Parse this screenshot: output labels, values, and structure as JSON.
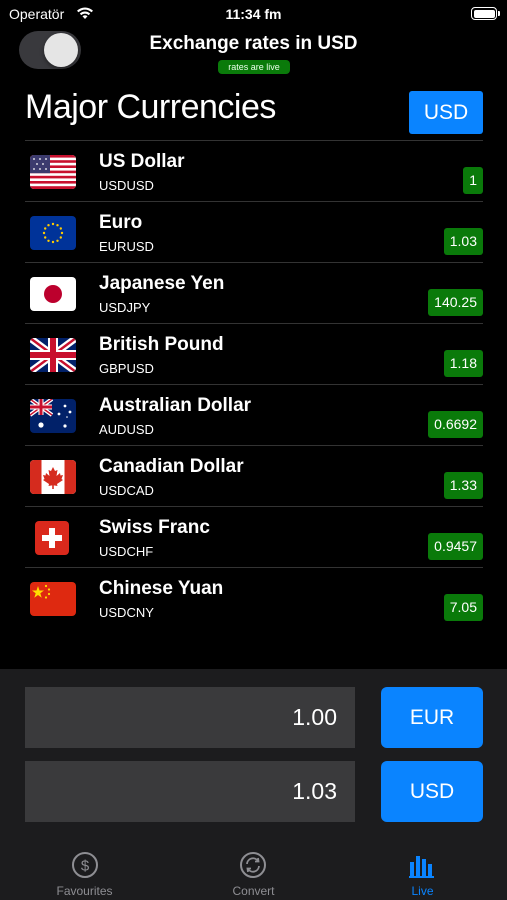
{
  "status": {
    "carrier": "Operatör",
    "time": "11:34 fm"
  },
  "header": {
    "title": "Exchange rates in USD",
    "live_badge": "rates are live"
  },
  "section": {
    "title": "Major Currencies",
    "base_button": "USD"
  },
  "currencies": [
    {
      "name": "US Dollar",
      "code": "USDUSD",
      "rate": "1",
      "flag": "us-flag"
    },
    {
      "name": "Euro",
      "code": "EURUSD",
      "rate": "1.03",
      "flag": "eu-flag"
    },
    {
      "name": "Japanese Yen",
      "code": "USDJPY",
      "rate": "140.25",
      "flag": "jp-flag"
    },
    {
      "name": "British Pound",
      "code": "GBPUSD",
      "rate": "1.18",
      "flag": "gb-flag"
    },
    {
      "name": "Australian Dollar",
      "code": "AUDUSD",
      "rate": "0.6692",
      "flag": "au-flag"
    },
    {
      "name": "Canadian Dollar",
      "code": "USDCAD",
      "rate": "1.33",
      "flag": "ca-flag"
    },
    {
      "name": "Swiss Franc",
      "code": "USDCHF",
      "rate": "0.9457",
      "flag": "ch-flag"
    },
    {
      "name": "Chinese Yuan",
      "code": "USDCNY",
      "rate": "7.05",
      "flag": "cn-flag"
    }
  ],
  "converter": {
    "from_amount": "1.00",
    "from_currency": "EUR",
    "to_amount": "1.03",
    "to_currency": "USD"
  },
  "tabs": [
    {
      "label": "Favourites",
      "icon": "dollar-circle-icon",
      "active": false
    },
    {
      "label": "Convert",
      "icon": "convert-arrows-icon",
      "active": false
    },
    {
      "label": "Live",
      "icon": "bar-chart-icon",
      "active": true
    }
  ],
  "colors": {
    "accent": "#0a84ff",
    "rate_badge": "#0a7a0a",
    "background": "#000000"
  }
}
